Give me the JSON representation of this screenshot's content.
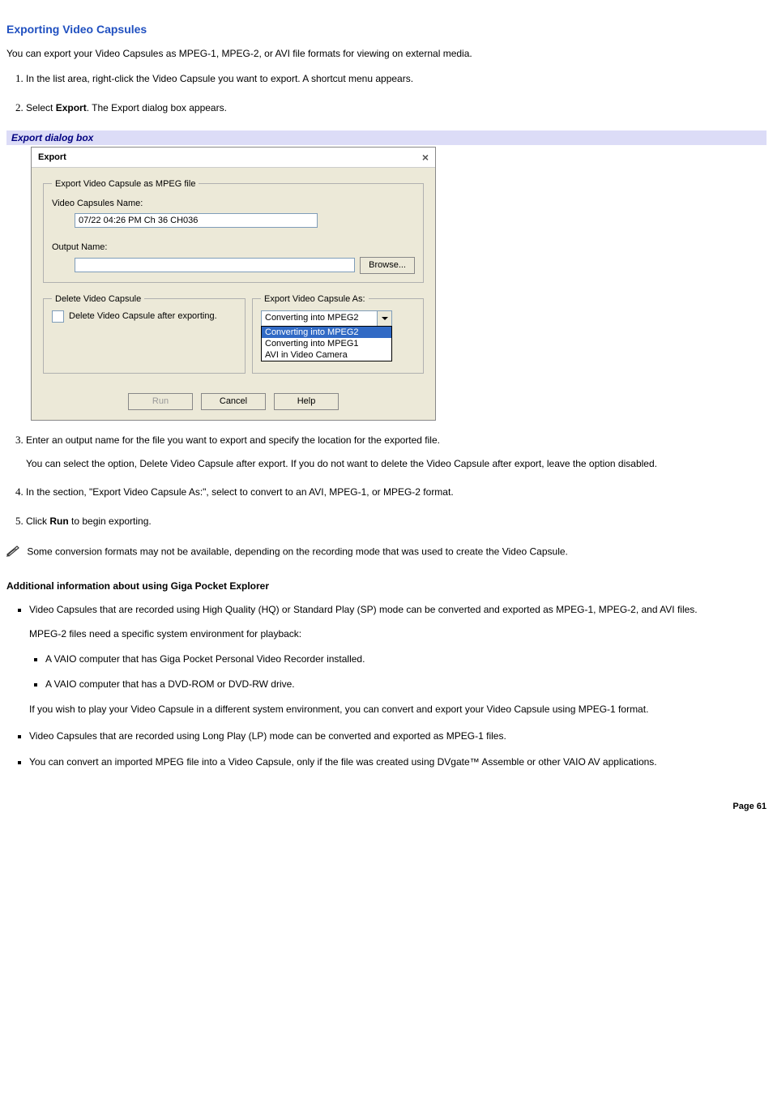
{
  "heading": "Exporting Video Capsules",
  "intro": "You can export your Video Capsules as MPEG-1, MPEG-2, or AVI file formats for viewing on external media.",
  "step1": "In the list area, right-click the Video Capsule you want to export. A shortcut menu appears.",
  "step2_a": "Select ",
  "step2_b": "Export",
  "step2_c": ". The Export dialog box appears.",
  "caption": "Export dialog box",
  "dialog": {
    "title": "Export",
    "close": "×",
    "fs1_legend": "Export Video Capsule as MPEG file",
    "lbl_vcname": "Video Capsules Name:",
    "vcname_value": "07/22 04:26 PM Ch 36 CH036",
    "lbl_output": "Output Name:",
    "output_value": "",
    "browse": "Browse...",
    "fs2_legend": "Delete Video Capsule",
    "chk_label": "Delete Video Capsule after exporting.",
    "fs3_legend": "Export Video Capsule As:",
    "combo_value": "Converting into MPEG2",
    "opt1": "Converting into MPEG2",
    "opt2": "Converting into MPEG1",
    "opt3": "AVI in Video Camera",
    "btn_run": "Run",
    "btn_cancel": "Cancel",
    "btn_help": "Help"
  },
  "step3_a": "Enter an output name for the file you want to export and specify the location for the exported file.",
  "step3_b": "You can select the option, Delete Video Capsule after export. If you do not want to delete the Video Capsule after export, leave the option disabled.",
  "step4": "In the section, \"Export Video Capsule As:\", select to convert to an AVI, MPEG-1, or MPEG-2 format.",
  "step5_a": "Click ",
  "step5_b": "Run",
  "step5_c": " to begin exporting.",
  "note": "Some conversion formats may not be available, depending on the recording mode that was used to create the Video Capsule.",
  "sub_heading": "Additional information about using Giga Pocket Explorer",
  "b1_a": "Video Capsules that are recorded using High Quality (HQ) or Standard Play (SP) mode can be converted and exported as MPEG-1, MPEG-2, and AVI files.",
  "b1_b": "MPEG-2 files need a specific system environment for playback:",
  "sub1": "A VAIO computer that has Giga Pocket Personal Video Recorder installed.",
  "sub2": "A VAIO computer that has a DVD-ROM or DVD-RW drive.",
  "b1_c": "If you wish to play your Video Capsule in a different system environment, you can convert and export your Video Capsule using MPEG-1 format.",
  "b2": "Video Capsules that are recorded using Long Play (LP) mode can be converted and exported as MPEG-1 files.",
  "b3": "You can convert an imported MPEG file into a Video Capsule, only if the file was created using DVgate™ Assemble or other VAIO AV applications.",
  "page": "Page 61"
}
